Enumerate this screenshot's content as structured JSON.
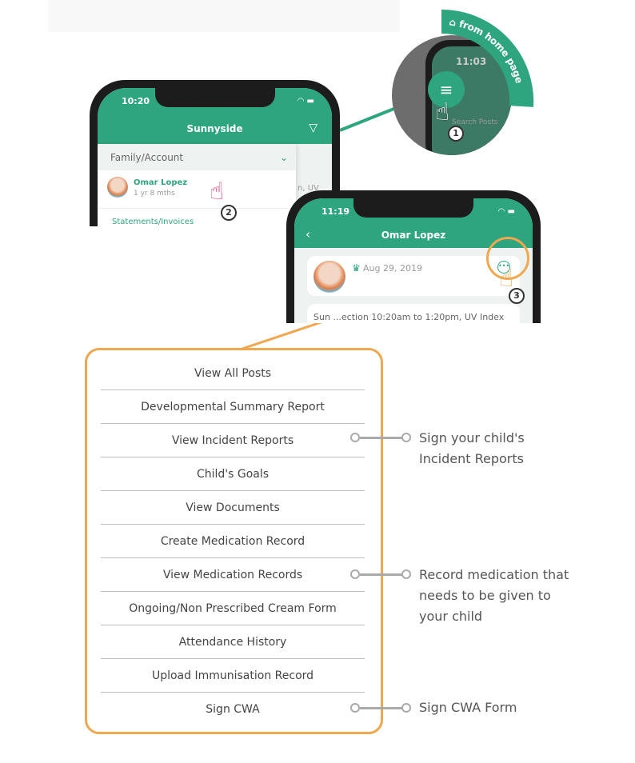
{
  "colors": {
    "brand_green": "#2ea57f",
    "highlight_orange": "#f0a850",
    "connector_gray": "#aaaaaa"
  },
  "zoom_callout": {
    "label": "from home page",
    "time": "11:03",
    "search_placeholder": "Search Posts",
    "step": "1",
    "icon": "hamburger-menu-icon",
    "home_icon": "home-icon"
  },
  "phone1": {
    "time": "10:20",
    "title": "Sunnyside",
    "filter_icon": "filter-icon",
    "dropdown_label": "Family/Account",
    "child_name": "Omar Lopez",
    "child_age": "1 yr 8 mths",
    "next_section": "Statements/Invoices",
    "behind_text": "n, UV",
    "step": "2"
  },
  "phone2": {
    "time": "11:19",
    "title": "Omar Lopez",
    "birthday": "Aug 29, 2019",
    "post_text": "Sun ...ection 10:20am to 1:20pm, UV Index",
    "step": "3",
    "more_icon": "more-options-icon"
  },
  "menu": {
    "items": [
      "View All Posts",
      "Developmental Summary Report",
      "View Incident Reports",
      "Child's Goals",
      "View Documents",
      "Create Medication Record",
      "View Medication Records",
      "Ongoing/Non Prescribed Cream Form",
      "Attendance History",
      "Upload Immunisation Record",
      "Sign CWA"
    ]
  },
  "annotations": [
    {
      "item": "View Incident Reports",
      "lines": [
        "Sign your child's",
        "Incident Reports"
      ]
    },
    {
      "item": "View Medication Records",
      "lines": [
        "Record medication that",
        "needs to be given to",
        "your child"
      ]
    },
    {
      "item": "Sign CWA",
      "lines": [
        "Sign CWA Form"
      ]
    }
  ]
}
